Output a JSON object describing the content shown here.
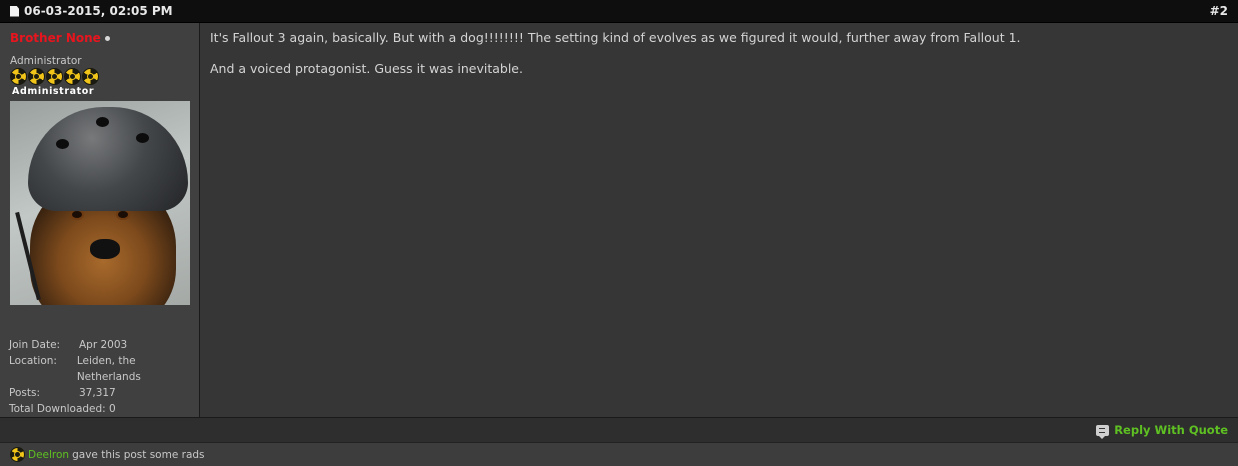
{
  "header": {
    "date": "06-03-2015, 02:05 PM",
    "post_number": "#2"
  },
  "user": {
    "username": "Brother None",
    "title": "Administrator",
    "rank_label": "Administrator",
    "rank_icon_count": 5,
    "stats": [
      {
        "label": "Join Date:",
        "value": "Apr 2003"
      },
      {
        "label": "Location:",
        "value": "Leiden, the Netherlands"
      },
      {
        "label": "Posts:",
        "value": "37,317"
      },
      {
        "label": "Total Downloaded:",
        "value": "0"
      }
    ]
  },
  "post": {
    "paragraphs": [
      "It's Fallout 3 again, basically. But with a dog!!!!!!!! The setting kind of evolves as we figured it would, further away from Fallout 1.",
      "And a voiced protagonist. Guess it was inevitable."
    ]
  },
  "footer": {
    "reply_quote_label": "Reply With Quote"
  },
  "rads": {
    "user": "Deelron",
    "text": "gave this post some rads"
  },
  "colors": {
    "username": "#e8141e",
    "link_green": "#5ec022",
    "background": "#363636"
  }
}
